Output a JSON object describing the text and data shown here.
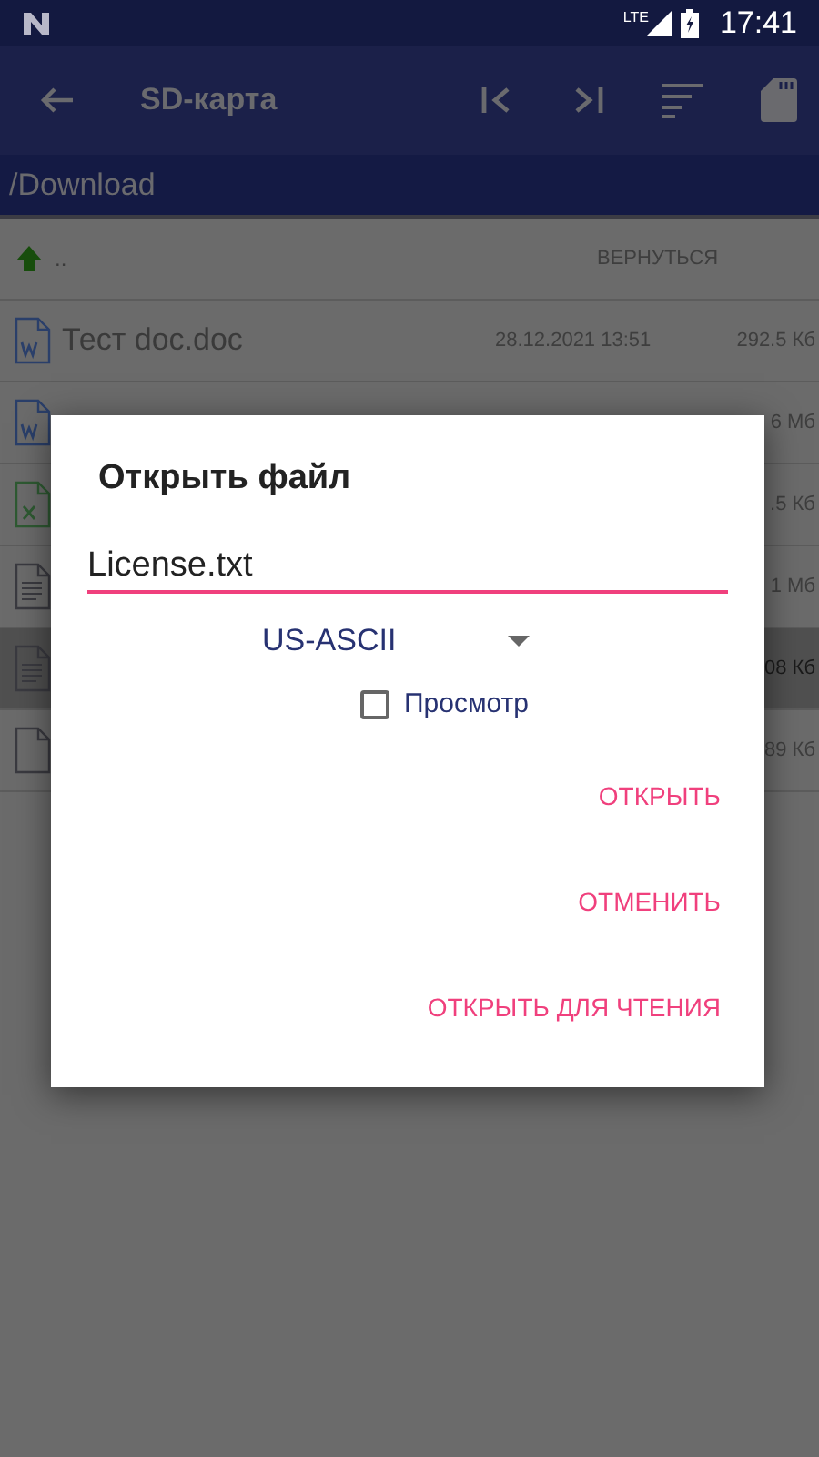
{
  "status_bar": {
    "time": "17:41",
    "network": "LTE"
  },
  "toolbar": {
    "title": "SD-карта"
  },
  "path": "/Download",
  "files": [
    {
      "kind": "up",
      "name": "..",
      "date": "ВЕРНУТЬСЯ",
      "selected": false
    },
    {
      "kind": "word",
      "name": "Тест doc.doc",
      "date": "28.12.2021 13:51",
      "size": "292.5 Кб",
      "selected": false
    },
    {
      "kind": "word",
      "size": "6 Мб",
      "selected": false
    },
    {
      "kind": "excel",
      "size": ".5 Кб",
      "selected": false
    },
    {
      "kind": "text",
      "size": "1 Мб",
      "selected": false
    },
    {
      "kind": "text",
      "size": "08 Кб",
      "selected": true
    },
    {
      "kind": "file",
      "size": "89 Кб",
      "selected": false
    }
  ],
  "dialog": {
    "title": "Открыть файл",
    "value": "License.txt",
    "encoding": "US-ASCII",
    "preview": {
      "label": "Просмотр",
      "checked": false
    },
    "buttons": [
      "ОТКРЫТЬ",
      "ОТМЕНИТЬ",
      "ОТКРЫТЬ ДЛЯ ЧТЕНИЯ"
    ]
  }
}
